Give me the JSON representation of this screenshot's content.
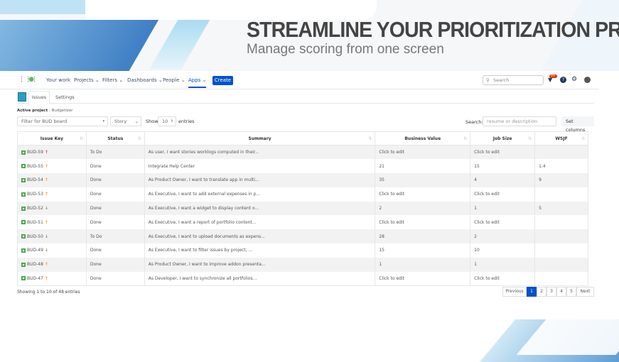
{
  "banner": {
    "headline": "STREAMLINE YOUR PRIORITIZATION PROCESS",
    "subtitle": "Manage scoring from one screen"
  },
  "nav": {
    "items": [
      "Your work",
      "Projects",
      "Filters",
      "Dashboards",
      "People",
      "Apps"
    ],
    "create": "Create",
    "search_placeholder": "Search",
    "notification_badge": "9+"
  },
  "tabs": [
    "Issues",
    "Settings"
  ],
  "active_project": {
    "label": "Active project",
    "value": "Budgetizer"
  },
  "filters": {
    "board": "Filter for BUD board",
    "type": "Story",
    "show_label": "Show",
    "entries_value": "10",
    "entries_label": "entries",
    "search_label": "Search:",
    "search_placeholder": "resume or description",
    "set_columns": "Set columns"
  },
  "table": {
    "headers": [
      "Issue Key",
      "Status",
      "Summary",
      "Business Value",
      "Job Size",
      "WSJF"
    ],
    "rows": [
      {
        "key": "BUD-59",
        "priority": "highest",
        "status": "To Do",
        "summary": "As user, I want stories worklogs computed in their...",
        "bv": "Click to edit",
        "js": "Click to edit",
        "wsjf": ""
      },
      {
        "key": "BUD-55",
        "priority": "high",
        "status": "Done",
        "summary": "Integrate Help Center",
        "bv": "21",
        "js": "15",
        "wsjf": "1.4"
      },
      {
        "key": "BUD-54",
        "priority": "high",
        "status": "Done",
        "summary": "As Product Owner, I want to translate app in multi...",
        "bv": "35",
        "js": "4",
        "wsjf": "9"
      },
      {
        "key": "BUD-53",
        "priority": "high",
        "status": "Done",
        "summary": "As Executive, I want to add external expenses in p...",
        "bv": "Click to edit",
        "js": "Click to edit",
        "wsjf": ""
      },
      {
        "key": "BUD-52",
        "priority": "low",
        "status": "Done",
        "summary": "As Executive, I want a widget to display content o...",
        "bv": "2",
        "js": "1",
        "wsjf": "5"
      },
      {
        "key": "BUD-51",
        "priority": "high",
        "status": "Done",
        "summary": "As Executive, I want a report of portfolio content...",
        "bv": "Click to edit",
        "js": "Click to edit",
        "wsjf": ""
      },
      {
        "key": "BUD-50",
        "priority": "low",
        "status": "To Do",
        "summary": "As Executive, I want to upload documents as expens...",
        "bv": "28",
        "js": "2",
        "wsjf": ""
      },
      {
        "key": "BUD-49",
        "priority": "low",
        "status": "Done",
        "summary": "As Executive, I want to filter issues by project, ...",
        "bv": "15",
        "js": "10",
        "wsjf": ""
      },
      {
        "key": "BUD-48",
        "priority": "high",
        "status": "Done",
        "summary": "As Product Owner, I want to improve addon presenta...",
        "bv": "1",
        "js": "1",
        "wsjf": ""
      },
      {
        "key": "BUD-47",
        "priority": "high",
        "status": "Done",
        "summary": "As Developer, I want to synchronize all portfolios...",
        "bv": "Click to edit",
        "js": "Click to edit",
        "wsjf": ""
      }
    ]
  },
  "footer": {
    "info": "Showing 1 to 10 of 48 entries",
    "previous": "Previous",
    "pages": [
      "1",
      "2",
      "3",
      "4",
      "5"
    ],
    "next": "Next"
  },
  "colors": {
    "accent": "#0052cc",
    "highest": "#d04437",
    "high": "#f79232",
    "low": "#5ba545"
  }
}
